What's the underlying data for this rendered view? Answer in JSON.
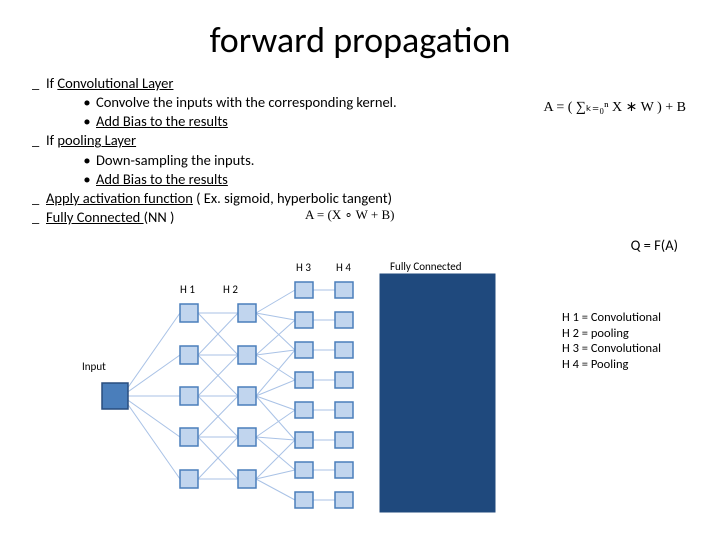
{
  "title": "forward propagation",
  "text": {
    "conv_if": "If  Convolutional Layer",
    "conv1": "Convolve the inputs with the corresponding kernel.",
    "conv2": "Add Bias to the results",
    "pool_if": "If pooling Layer",
    "pool1": "Down-sampling the inputs.",
    "pool2": "Add Bias to the results",
    "act": "Apply activation function",
    "act_suffix": " ( Ex. sigmoid, hyperbolic tangent)",
    "fc": "Fully Connected ",
    "fc_suffix": "(NN )",
    "qfa": "Q = F(A)"
  },
  "formula": {
    "f1": "A = ( ∑ₖ₌₀ⁿ X ∗ W ) + B",
    "f2": "A = (X ∘ W + B)"
  },
  "labels": {
    "input": "Input",
    "h1": "H 1",
    "h2": "H 2",
    "h3": "H 3",
    "h4": "H 4",
    "fc": "Fully Connected"
  },
  "legend": {
    "l1": "H 1 = Convolutional",
    "l2": "H 2 = pooling",
    "l3": "H 3 = Convolutional",
    "l4": "H 4 = Pooling"
  },
  "dash": "_",
  "dot": "•"
}
